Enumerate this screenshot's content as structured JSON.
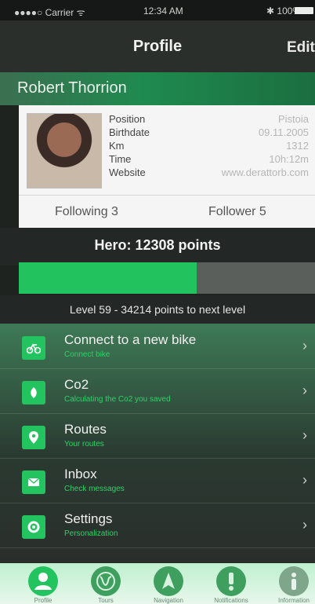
{
  "status": {
    "carrier": "●●●●○ Carrier ᯤ",
    "time": "12:34 AM",
    "battery": "✱ 100%"
  },
  "navbar": {
    "title": "Profile",
    "edit_label": "Edit"
  },
  "profile": {
    "name": "Robert Thorrion",
    "fields": [
      {
        "label": "Position",
        "value": "Pistoia"
      },
      {
        "label": "Birthdate",
        "value": "09.11.2005"
      },
      {
        "label": "Km",
        "value": "1312"
      },
      {
        "label": "Time",
        "value": "10h:12m"
      },
      {
        "label": "Website",
        "value": "www.derattorb.com"
      }
    ],
    "following": "Following 3",
    "follower": "Follower 5"
  },
  "hero": {
    "title": "Hero: 12308 points",
    "progress": 0.6
  },
  "level": "Level 59 - 34214 points to next level",
  "menu": [
    {
      "label": "Connect to a new bike",
      "sub": "Connect bike",
      "icon": "bike-icon"
    },
    {
      "label": "Co2",
      "sub": "Calculating the Co2 you saved",
      "icon": "leaf-icon"
    },
    {
      "label": "Routes",
      "sub": "Your routes",
      "icon": "pin-icon"
    },
    {
      "label": "Inbox",
      "sub": "Check messages",
      "icon": "mail-icon"
    },
    {
      "label": "Settings",
      "sub": "Personalization",
      "icon": "gear-icon"
    }
  ],
  "tabs": [
    {
      "label": "Profile",
      "icon": "person-icon",
      "color": "#23c45f"
    },
    {
      "label": "Tours",
      "icon": "globe-icon",
      "color": "#3f9f5e"
    },
    {
      "label": "Navigation",
      "icon": "navigation-icon",
      "color": "#3f9f5e"
    },
    {
      "label": "Notifications",
      "icon": "alert-icon",
      "color": "#3f9f5e"
    },
    {
      "label": "Information",
      "icon": "info-icon",
      "color": "#7fa58b"
    }
  ],
  "colors": {
    "accent": "#23c45f",
    "header": "#2a2f2b"
  }
}
